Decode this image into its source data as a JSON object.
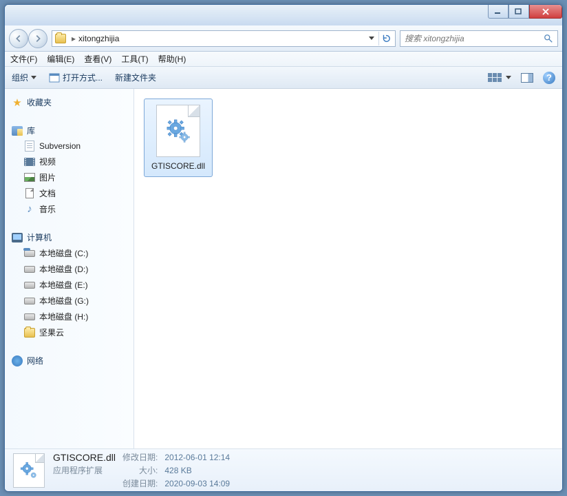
{
  "address": {
    "crumb": "xitongzhijia"
  },
  "search": {
    "placeholder": "搜索 xitongzhijia"
  },
  "menu": {
    "file": "文件(F)",
    "edit": "编辑(E)",
    "view": "查看(V)",
    "tools": "工具(T)",
    "help": "帮助(H)"
  },
  "toolbar": {
    "organize": "组织",
    "openwith": "打开方式...",
    "newfolder": "新建文件夹"
  },
  "sidebar": {
    "favorites": "收藏夹",
    "libraries": "库",
    "lib_items": {
      "subversion": "Subversion",
      "video": "视频",
      "pictures": "图片",
      "documents": "文档",
      "music": "音乐"
    },
    "computer": "计算机",
    "drives": {
      "c": "本地磁盘 (C:)",
      "d": "本地磁盘 (D:)",
      "e": "本地磁盘 (E:)",
      "g": "本地磁盘 (G:)",
      "h": "本地磁盘 (H:)",
      "jianguo": "坚果云"
    },
    "network": "网络"
  },
  "file": {
    "name": "GTISCORE.dll"
  },
  "details": {
    "name": "GTISCORE.dll",
    "type": "应用程序扩展",
    "modified_label": "修改日期:",
    "modified": "2012-06-01 12:14",
    "size_label": "大小:",
    "size": "428 KB",
    "created_label": "创建日期:",
    "created": "2020-09-03 14:09"
  }
}
